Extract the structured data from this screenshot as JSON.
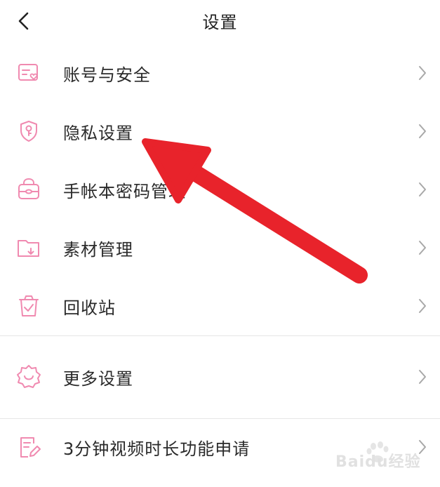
{
  "header": {
    "title": "设置",
    "back_icon": "chevron-left-icon"
  },
  "items": [
    {
      "label": "账号与安全",
      "icon": "account-card-icon"
    },
    {
      "label": "隐私设置",
      "icon": "privacy-shield-icon"
    },
    {
      "label": "手帐本密码管理",
      "icon": "password-bag-icon"
    },
    {
      "label": "素材管理",
      "icon": "folder-download-icon"
    },
    {
      "label": "回收站",
      "icon": "recycle-bin-icon"
    },
    {
      "label": "更多设置",
      "icon": "gear-icon"
    },
    {
      "label": "3分钟视频时长功能申请",
      "icon": "document-edit-icon"
    }
  ],
  "colors": {
    "accent_icon": "#f08ab0",
    "chevron": "#a8a8a8",
    "annotation_arrow": "#e8232b"
  },
  "watermark": {
    "text": "Baidu经验"
  }
}
